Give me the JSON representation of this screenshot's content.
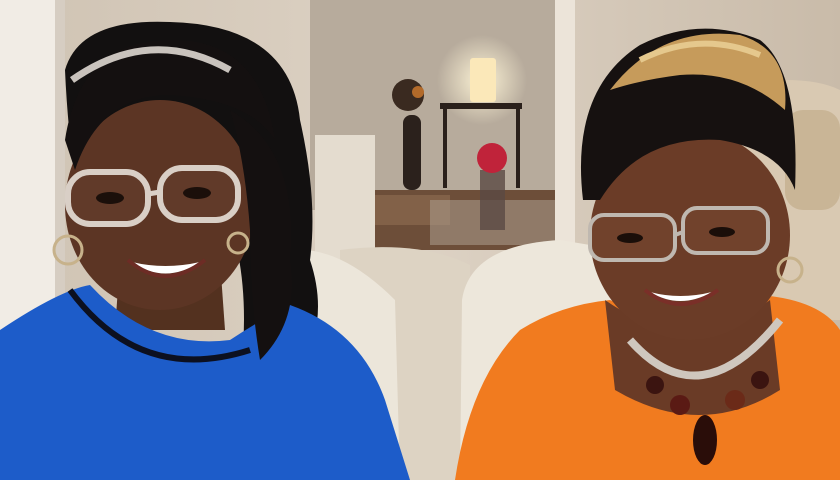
{
  "scene": {
    "description_name": "two-women-interview-frame",
    "palette": {
      "wall": "#d8cdbf",
      "wall_shadow": "#b9ab9a",
      "doorframe": "#efe9e1",
      "floor": "#7a5a43",
      "couch": "#e7ddcd",
      "lamp_glow": "#fff2cf",
      "blue_top": "#1c5cc8",
      "orange_top": "#f07a1e",
      "skin_left": "#5b3524",
      "skin_right": "#6a3b26",
      "hair_dark": "#14100e",
      "hair_blond": "#c59a5a"
    }
  }
}
